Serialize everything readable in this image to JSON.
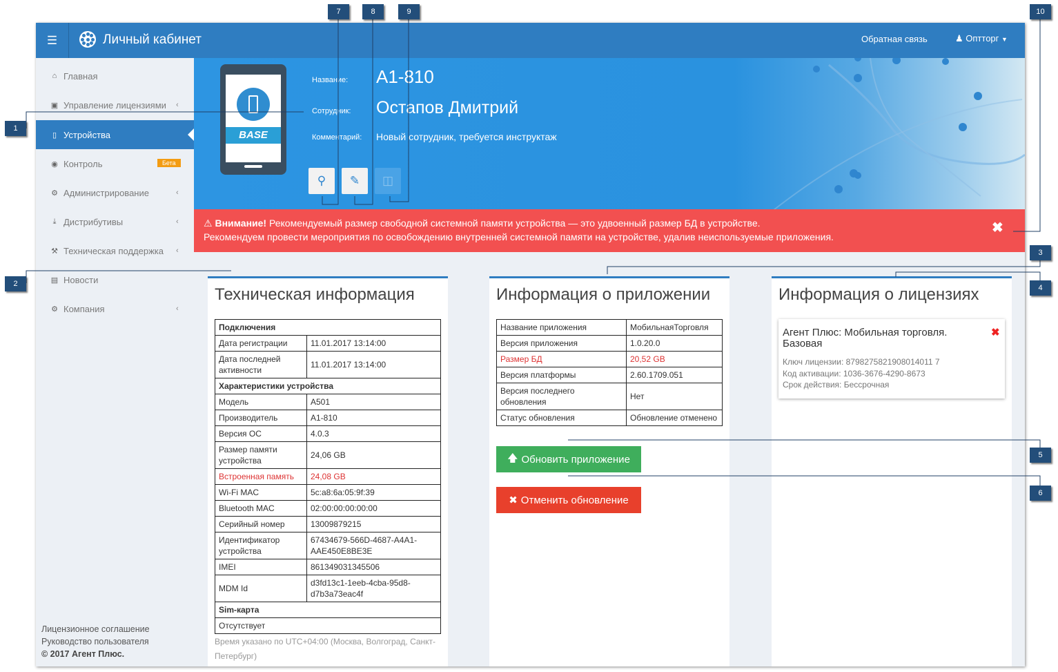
{
  "header": {
    "menu_icon": "hamburger-icon",
    "brand": "Личный кабинет",
    "feedback": "Обратная связь",
    "user": "Оптторг"
  },
  "sidebar": {
    "items": [
      {
        "label": "Главная",
        "icon": "home-icon"
      },
      {
        "label": "Управление лицензиями",
        "icon": "sitemap-icon"
      },
      {
        "label": "Устройства",
        "icon": "mobile-icon"
      },
      {
        "label": "Контроль",
        "icon": "globe-icon",
        "badge": "Бета"
      },
      {
        "label": "Администрирование",
        "icon": "cogs-icon"
      },
      {
        "label": "Дистрибутивы",
        "icon": "download-icon"
      },
      {
        "label": "Техническая поддержка",
        "icon": "wrench-icon"
      },
      {
        "label": "Новости",
        "icon": "newspaper-icon"
      },
      {
        "label": "Компания",
        "icon": "cog-icon"
      }
    ],
    "footer": {
      "license": "Лицензионное соглашение",
      "guide": "Руководство пользователя",
      "copyright": "© 2017 Агент Плюс."
    }
  },
  "device": {
    "badge": "BASE",
    "name_label": "Название:",
    "name": "A1-810",
    "employee_label": "Сотрудник:",
    "employee": "Остапов Дмитрий",
    "comment_label": "Комментарий:",
    "comment": "Новый сотрудник, требуется инструктаж"
  },
  "alert": {
    "title": "Внимание!",
    "line1": "Рекомендуемый размер свободной системной памяти устройства — это удвоенный размер БД в устройстве.",
    "line2": "Рекомендуем провести мероприятия по освобождению внутренней системной памяти на устройстве, удалив неиспользуемые приложения."
  },
  "tech": {
    "title": "Техническая информация",
    "rows": [
      {
        "k": "Подключения",
        "section": true
      },
      {
        "k": "Дата регистрации",
        "v": "11.01.2017 13:14:00"
      },
      {
        "k": "Дата последней активности",
        "v": "11.01.2017 13:14:00"
      },
      {
        "k": "Характеристики устройства",
        "section": true
      },
      {
        "k": "Модель",
        "v": "A501"
      },
      {
        "k": "Производитель",
        "v": "A1-810"
      },
      {
        "k": "Версия ОС",
        "v": "4.0.3"
      },
      {
        "k": "Размер памяти устройства",
        "v": "24,06 GB"
      },
      {
        "k": "Встроенная память",
        "v": "24,08 GB",
        "warn": true
      },
      {
        "k": "Wi-Fi MAC",
        "v": "5c:a8:6a:05:9f:39"
      },
      {
        "k": "Bluetooth MAC",
        "v": "02:00:00:00:00:00"
      },
      {
        "k": "Серийный номер",
        "v": "13009879215"
      },
      {
        "k": "Идентификатор устройства",
        "v": "67434679-566D-4687-A4A1-AAE450E8BE3E"
      },
      {
        "k": "IMEI",
        "v": "861349031345506"
      },
      {
        "k": "MDM Id",
        "v": "d3fd13c1-1eeb-4cba-95d8-d7b3a73eac4f"
      },
      {
        "k": "Sim-карта",
        "section": true
      },
      {
        "k": "Отсутствует",
        "plain": true
      }
    ],
    "timezone": "Время указано по UTC+04:00 (Москва, Волгоград, Санкт-Петербург)"
  },
  "app": {
    "title": "Информация о приложении",
    "rows": [
      {
        "k": "Название приложения",
        "v": "МобильнаяТорговля"
      },
      {
        "k": "Версия приложения",
        "v": "1.0.20.0"
      },
      {
        "k": "Размер БД",
        "v": "20,52 GB",
        "warn": true
      },
      {
        "k": "Версия платформы",
        "v": "2.60.1709.051"
      },
      {
        "k": "Версия последнего обновления",
        "v": "Нет"
      },
      {
        "k": "Статус обновления",
        "v": "Обновление отменено"
      }
    ],
    "update_button": "Обновить приложение",
    "cancel_button": "Отменить обновление"
  },
  "license": {
    "title": "Информация о лицензиях",
    "card": {
      "name": "Агент Плюс: Мобильная торговля. Базовая",
      "key": "Ключ лицензии: 8798275821908014011 7",
      "code": "Код активации: 1036-3676-4290-8673",
      "term": "Срок действия: Бессрочная"
    }
  },
  "callouts": [
    "1",
    "2",
    "3",
    "4",
    "5",
    "6",
    "7",
    "8",
    "9",
    "10"
  ],
  "colors": {
    "primary": "#2f7dc1",
    "alert": "#f25050",
    "success": "#3fae5c",
    "danger": "#e8402c",
    "badge": "#f39c12"
  }
}
